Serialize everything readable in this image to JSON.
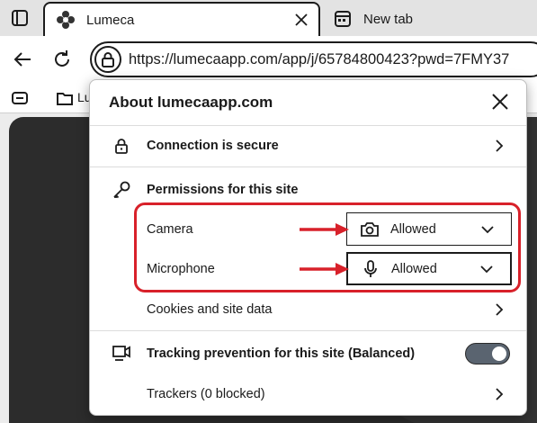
{
  "browser": {
    "tabs": [
      {
        "title": "Lumeca",
        "favicon": "lumeca-flower-icon",
        "active": true
      },
      {
        "title": "New tab",
        "favicon": "newtab-icon",
        "active": false
      }
    ],
    "url": "https://lumecaapp.com/app/j/65784800423?pwd=7FMY37",
    "favorites_folder_label": "Lu"
  },
  "popup": {
    "title": "About lumecaapp.com",
    "connection": {
      "label": "Connection is secure",
      "icon": "lock-icon"
    },
    "permissions": {
      "heading": "Permissions for this site",
      "icon": "key-icon",
      "items": [
        {
          "label": "Camera",
          "value": "Allowed",
          "icon": "camera-icon"
        },
        {
          "label": "Microphone",
          "value": "Allowed",
          "icon": "microphone-icon"
        }
      ]
    },
    "cookies": {
      "label": "Cookies and site data"
    },
    "tracking": {
      "label": "Tracking prevention for this site (Balanced)",
      "icon": "tracking-icon",
      "enabled": true
    },
    "trackers": {
      "label": "Trackers (0 blocked)"
    }
  },
  "colors": {
    "annotation_red": "#d8212a",
    "toggle_on": "#5a6470",
    "page_background": "#2c2c2c"
  }
}
